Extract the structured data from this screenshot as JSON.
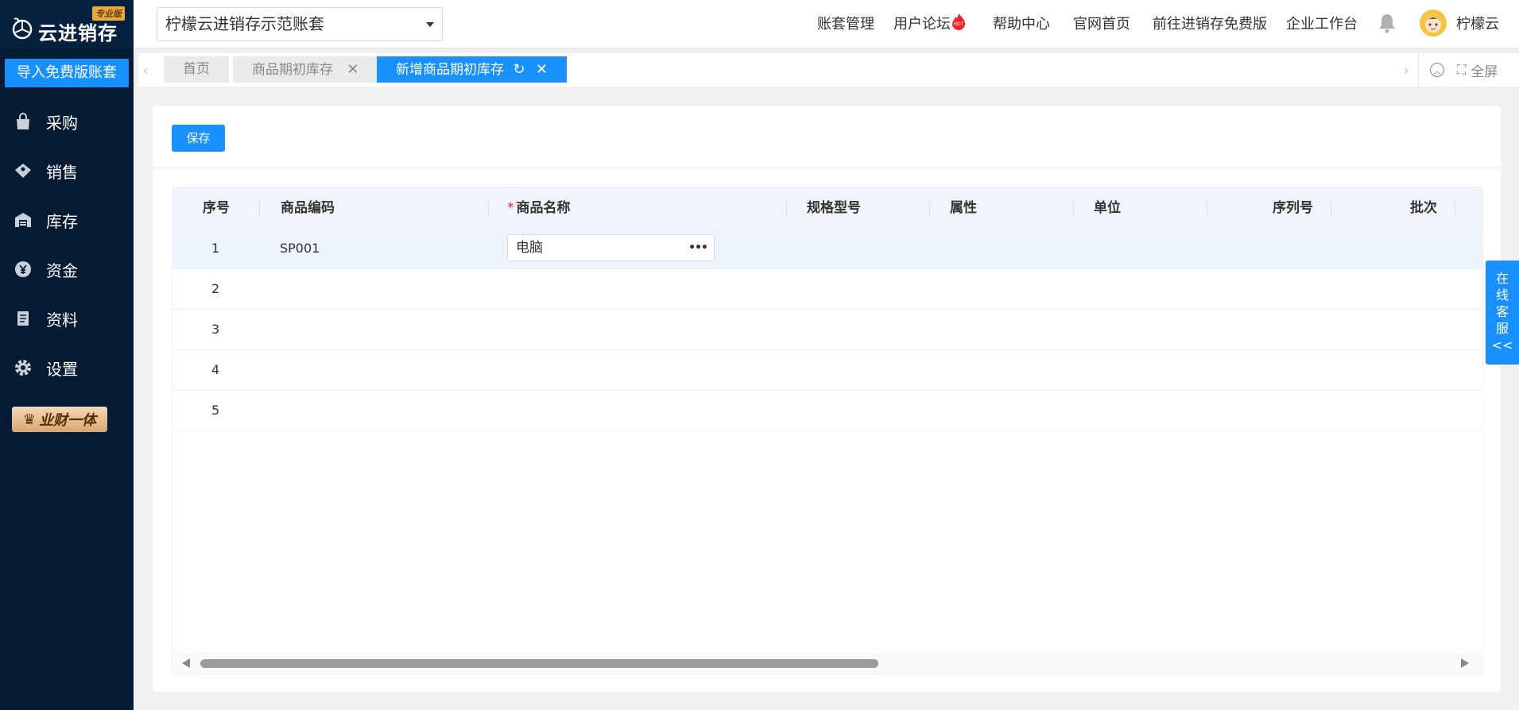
{
  "app": {
    "logo_text": "云进销存",
    "edition_badge": "专业版",
    "accent_color": "#1890ff",
    "sidebar_bg": "#051b33"
  },
  "sidebar": {
    "import_button": "导入免费版账套",
    "items": [
      {
        "label": "采购",
        "icon": "bag-icon"
      },
      {
        "label": "销售",
        "icon": "sales-tag-icon"
      },
      {
        "label": "库存",
        "icon": "warehouse-icon"
      },
      {
        "label": "资金",
        "icon": "yen-icon"
      },
      {
        "label": "资料",
        "icon": "document-icon"
      },
      {
        "label": "设置",
        "icon": "gear-icon"
      }
    ],
    "vip_badge": "业财一体"
  },
  "topbar": {
    "account_selected": "柠檬云进销存示范账套",
    "links": {
      "account_mgmt": "账套管理",
      "forum": "用户论坛",
      "hot_badge": "HOT",
      "help": "帮助中心",
      "website": "官网首页",
      "free_version": "前往进销存免费版",
      "workbench": "企业工作台"
    },
    "user_name": "柠檬云"
  },
  "tabs": {
    "items": [
      {
        "label": "首页"
      },
      {
        "label": "商品期初库存"
      },
      {
        "label": "新增商品期初库存"
      }
    ],
    "fullscreen": "全屏"
  },
  "toolbar": {
    "save_label": "保存"
  },
  "table": {
    "columns": {
      "seq": "序号",
      "code": "商品编码",
      "name_required_mark": "*",
      "name": "商品名称",
      "spec": "规格型号",
      "attr": "属性",
      "unit": "单位",
      "serial": "序列号",
      "batch": "批次"
    },
    "rows": [
      {
        "seq": "1",
        "code": "SP001",
        "name": "电脑"
      },
      {
        "seq": "2",
        "code": "",
        "name": ""
      },
      {
        "seq": "3",
        "code": "",
        "name": ""
      },
      {
        "seq": "4",
        "code": "",
        "name": ""
      },
      {
        "seq": "5",
        "code": "",
        "name": ""
      }
    ]
  },
  "service": {
    "label_chars": [
      "在",
      "线",
      "客",
      "服",
      "<<"
    ]
  }
}
